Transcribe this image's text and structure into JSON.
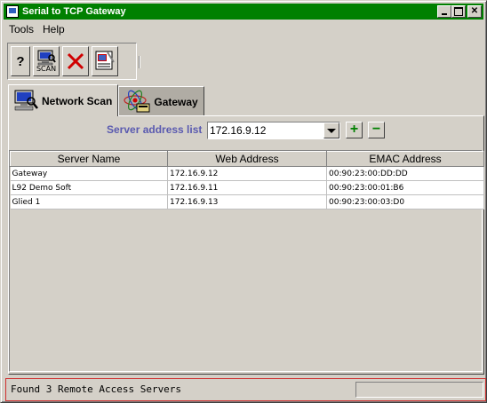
{
  "window": {
    "title": "Serial to TCP Gateway"
  },
  "menu": {
    "items": [
      {
        "label": "Tools"
      },
      {
        "label": "Help"
      }
    ]
  },
  "toolbar": {
    "help_label": "?",
    "scan_label": "SCAN"
  },
  "tabs": [
    {
      "label": "Network Scan",
      "active": true
    },
    {
      "label": "Gateway",
      "active": false
    }
  ],
  "server": {
    "label": "Server address list",
    "value": "172.16.9.12"
  },
  "table": {
    "columns": [
      "Server Name",
      "Web Address",
      "EMAC Address"
    ],
    "rows": [
      [
        "Gateway",
        "172.16.9.12",
        "00:90:23:00:DD:DD"
      ],
      [
        "L92 Demo Soft",
        "172.16.9.11",
        "00:90:23:00:01:B6"
      ],
      [
        "Glied 1",
        "172.16.9.13",
        "00:90:23:00:03:D0"
      ]
    ]
  },
  "status": {
    "text": "Found 3 Remote Access Servers"
  },
  "colors": {
    "titlebar": "#008000",
    "accent_label": "#5a5ab0",
    "plus_minus": "#008000"
  }
}
